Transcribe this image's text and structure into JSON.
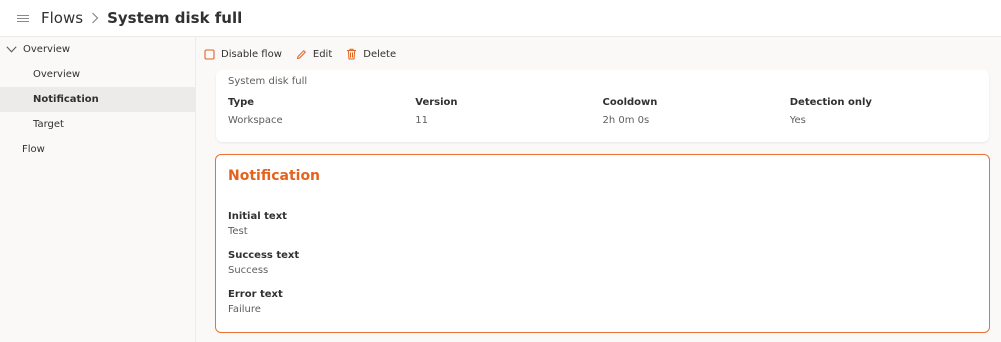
{
  "breadcrumb": {
    "parent": "Flows",
    "current": "System disk full"
  },
  "sidebar": {
    "group_label": "Overview",
    "items": [
      {
        "label": "Overview"
      },
      {
        "label": "Notification",
        "active": true
      },
      {
        "label": "Target"
      }
    ],
    "flow_label": "Flow"
  },
  "toolbar": {
    "disable_label": "Disable flow",
    "edit_label": "Edit",
    "delete_label": "Delete"
  },
  "summary": {
    "description": "System disk full",
    "properties": [
      {
        "label": "Type",
        "value": "Workspace"
      },
      {
        "label": "Version",
        "value": "11"
      },
      {
        "label": "Cooldown",
        "value": "2h 0m 0s"
      },
      {
        "label": "Detection only",
        "value": "Yes"
      }
    ]
  },
  "notification": {
    "title": "Notification",
    "fields": [
      {
        "label": "Initial text",
        "value": "Test"
      },
      {
        "label": "Success text",
        "value": "Success"
      },
      {
        "label": "Error text",
        "value": "Failure"
      }
    ]
  },
  "colors": {
    "accent": "#e4621e",
    "border_accent": "#e97132",
    "active_nav": "#edebe9"
  },
  "icons": [
    "hamburger-icon",
    "chevron-right-icon",
    "chevron-down-icon",
    "square-icon",
    "pencil-icon",
    "trash-icon"
  ]
}
